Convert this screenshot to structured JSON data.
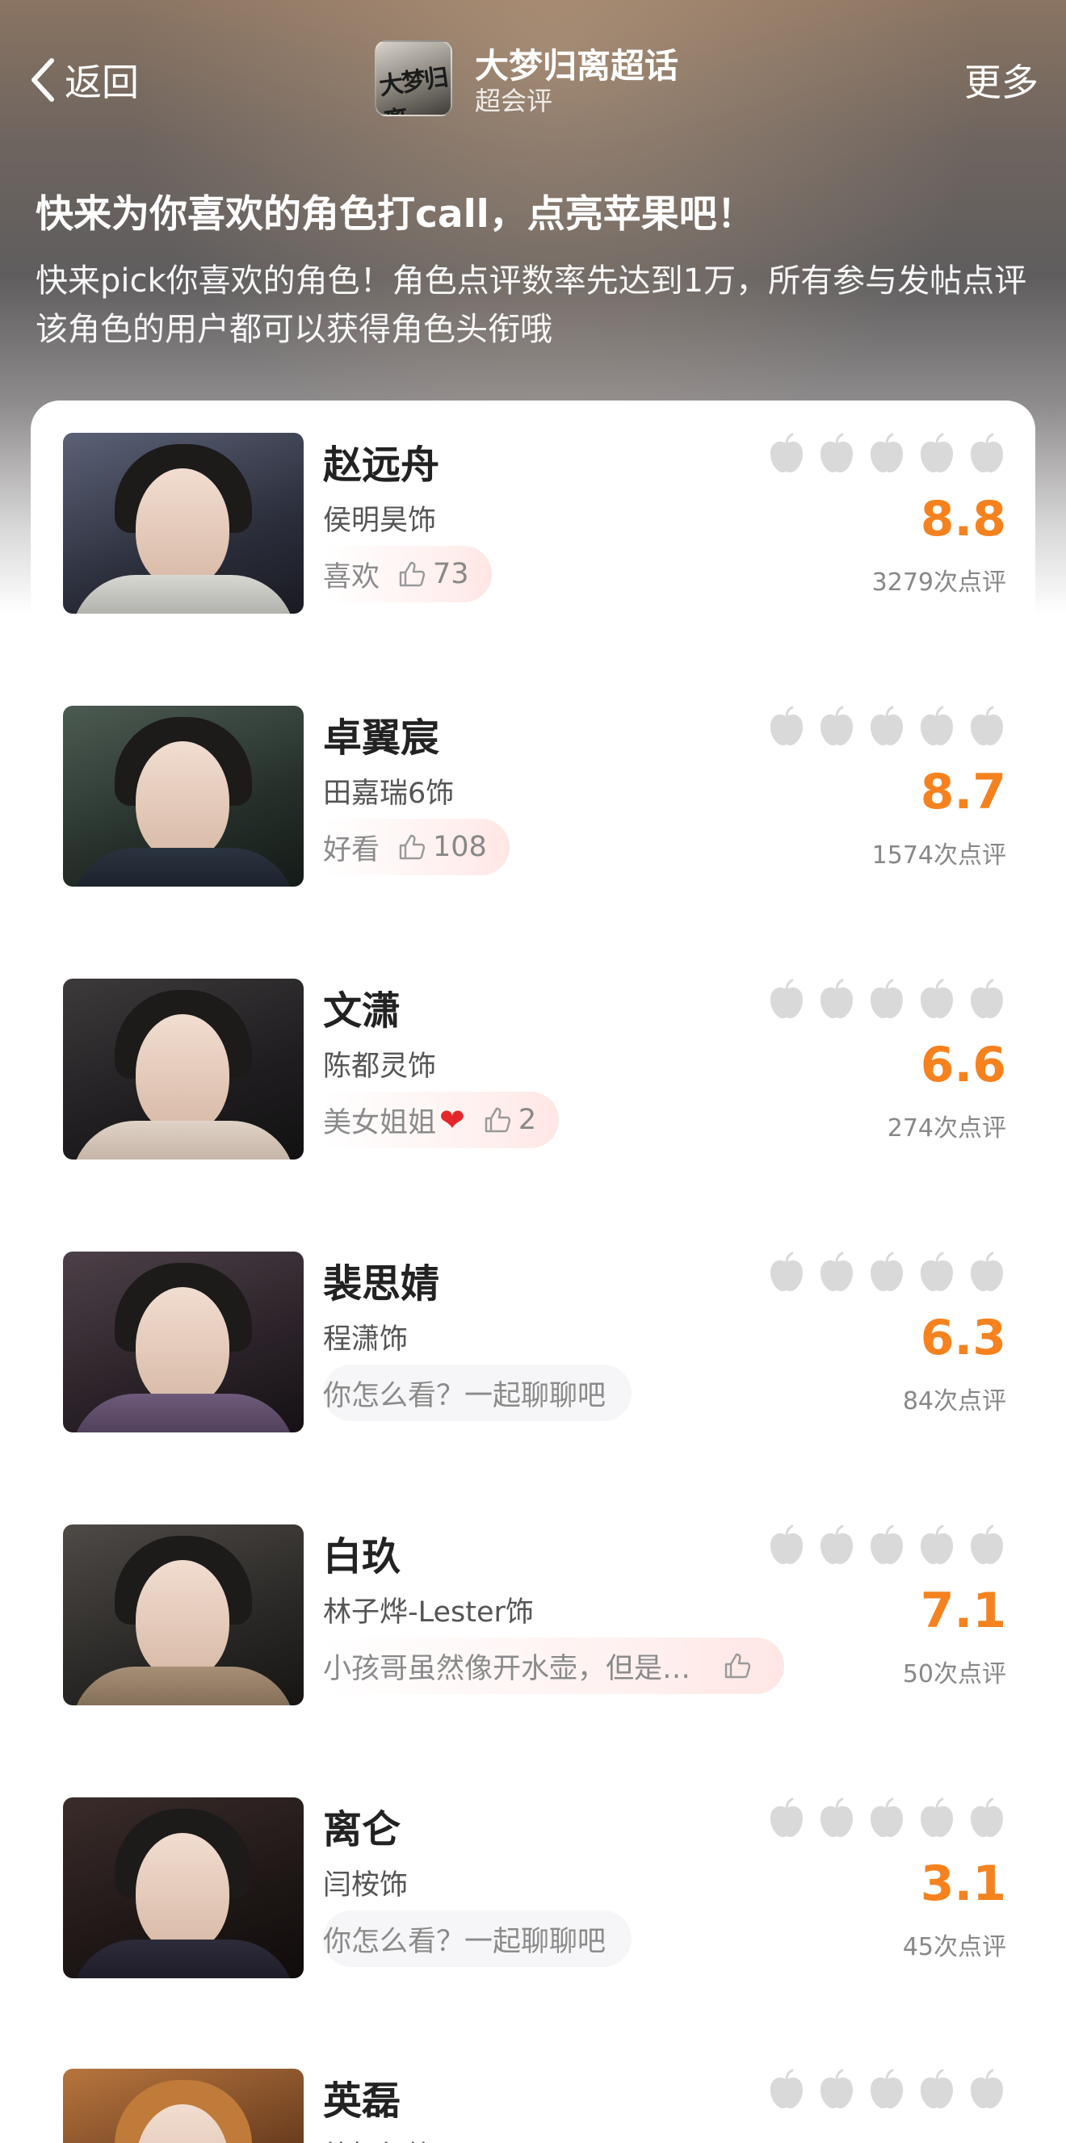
{
  "header": {
    "back_label": "返回",
    "logo_text": "大梦归离",
    "title": "大梦归离超话",
    "subtitle": "超会评",
    "more_label": "更多"
  },
  "headline": "快来为你喜欢的角色打call，点亮苹果吧！",
  "description": "快来pick你喜欢的角色！角色点评数率先达到1万，所有参与发帖点评该角色的用户都可以获得角色头衔哦",
  "characters": [
    {
      "name": "赵远舟",
      "actor": "侯明昊饰",
      "comment": "喜欢",
      "likes": "73",
      "score": "8.8",
      "reviews": "3279次点评"
    },
    {
      "name": "卓翼宸",
      "actor": "田嘉瑞6饰",
      "comment": "好看",
      "likes": "108",
      "score": "8.7",
      "reviews": "1574次点评"
    },
    {
      "name": "文潇",
      "actor": "陈都灵饰",
      "comment": "美女姐姐",
      "likes": "2",
      "score": "6.6",
      "reviews": "274次点评"
    },
    {
      "name": "裴思婧",
      "actor": "程潇饰",
      "comment": "你怎么看？一起聊聊吧",
      "likes": "",
      "score": "6.3",
      "reviews": "84次点评"
    },
    {
      "name": "白玖",
      "actor": "林子烨-Lester饰",
      "comment": "小孩哥虽然像开水壶，但是…",
      "likes": "",
      "score": "7.1",
      "reviews": "50次点评"
    },
    {
      "name": "离仑",
      "actor": "闫桉饰",
      "comment": "你怎么看？一起聊聊吧",
      "likes": "",
      "score": "3.1",
      "reviews": "45次点评"
    },
    {
      "name": "英磊",
      "actor": "徐振轩饰",
      "comment": "",
      "likes": "",
      "score": "",
      "reviews": ""
    }
  ],
  "icons": {
    "rating": "apple-icon",
    "like": "thumbs-up-icon",
    "back": "chevron-left-icon",
    "emoji": "red-heart"
  },
  "colors": {
    "score": "#f5821f",
    "apple_inactive": "#d9d9d9",
    "like_bubble": "#ffe6e4"
  }
}
